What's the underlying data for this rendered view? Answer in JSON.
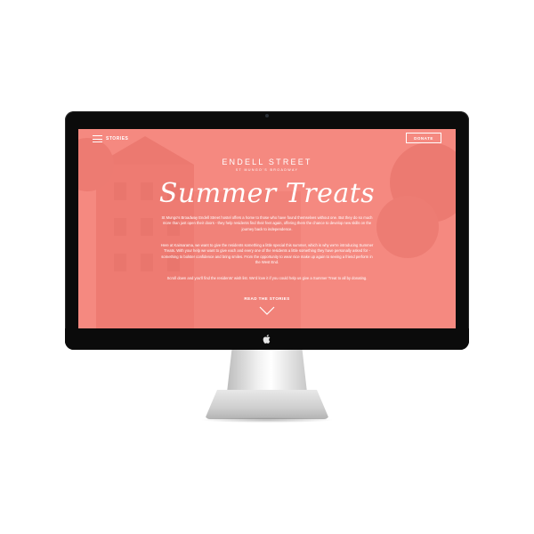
{
  "nav": {
    "menu_label": "STORIES",
    "donate_label": "DONATE"
  },
  "hero": {
    "location_title": "ENDELL STREET",
    "location_subtitle": "ST MUNGO'S BROADWAY",
    "campaign_title": "Summer Treats",
    "paragraphs": [
      "St Mungo's Broadway Endell Street hostel offers a home to those who have found themselves without one. But they do so much more than just open their doors - they help residents find their feet again, offering them the chance to develop new skills on the journey back to independence.",
      "Here at Kaimarama, we want to give the residents something a little special this summer, which is why we're introducing Summer Treats. With your help we want to give each and every one of the residents a little something they have personally asked for - something to bolster confidence and bring smiles. From the opportunity to wear nice make up again to seeing a friend perform in the West End.",
      "Scroll down and you'll find the residents' wish list. We'd love it if you could help us give a Summer Treat to all by donating."
    ],
    "cta_label": "READ THE STORIES"
  },
  "colors": {
    "overlay": "#f6807a",
    "bezel": "#0b0b0b",
    "text": "#ffffff"
  },
  "icons": {
    "menu": "hamburger-icon",
    "scroll": "chevron-down-icon",
    "brand": "apple-logo"
  }
}
